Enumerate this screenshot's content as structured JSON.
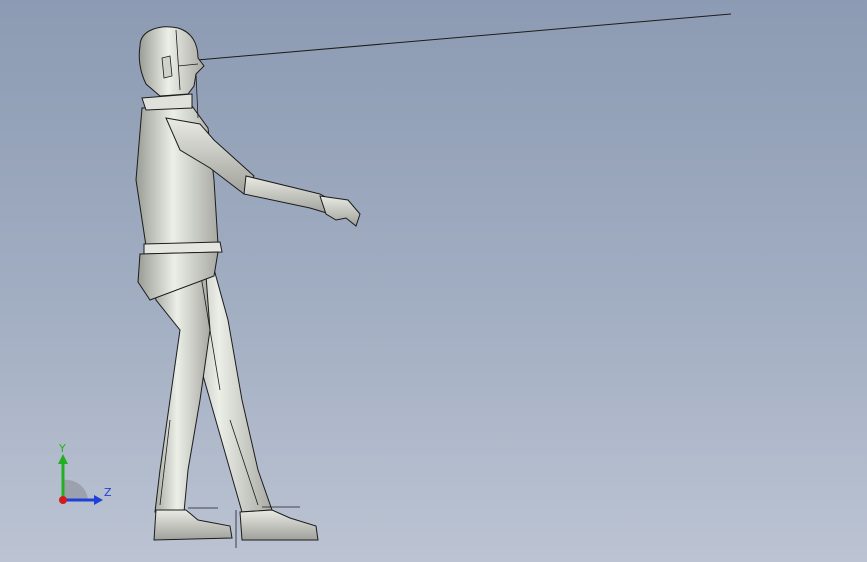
{
  "viewport": {
    "background_top": "#8c9bb3",
    "background_bottom": "#bcc4d3"
  },
  "model": {
    "description_icon": "human-mannequin-3d-model",
    "body_color": "#d4d6cf",
    "edge_color": "#1c1c1c"
  },
  "triad": {
    "y_label": "Y",
    "z_label": "Z",
    "y_color": "#22b022",
    "z_color": "#1f3fd6",
    "x_color": "#d21c1c"
  }
}
